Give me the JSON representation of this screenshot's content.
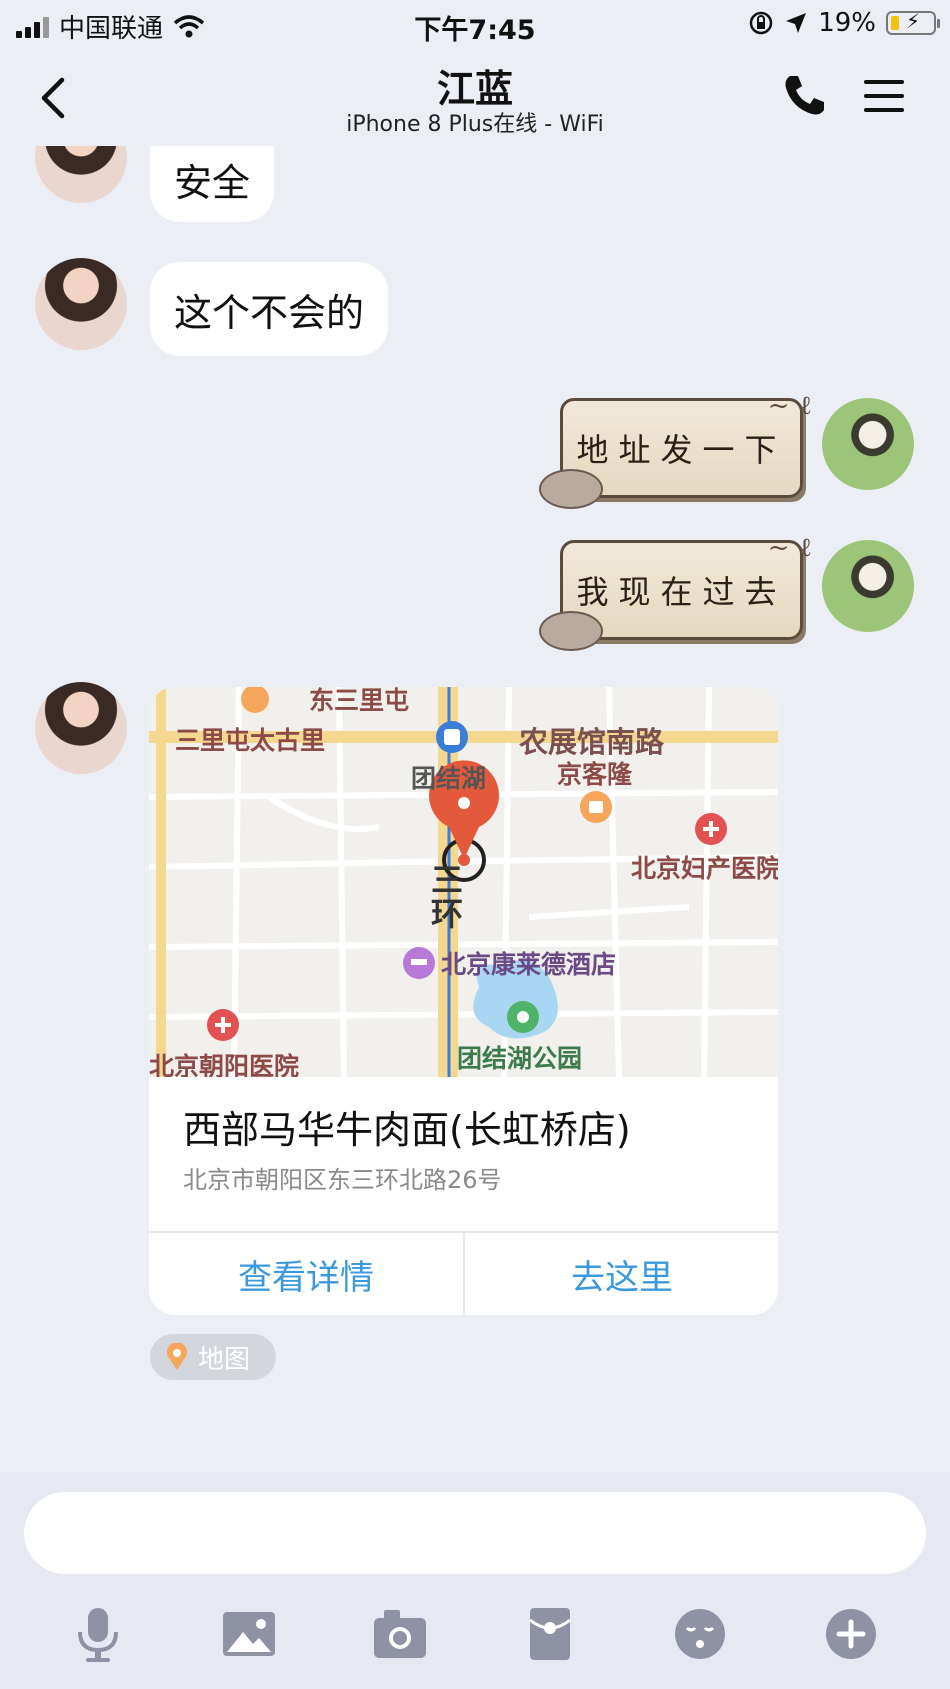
{
  "status_bar": {
    "carrier": "中国联通",
    "time": "下午7:45",
    "battery_percent": "19%",
    "battery_level": 0.19,
    "icons": [
      "signal-icon",
      "wifi-icon",
      "orientation-lock-icon",
      "location-arrow-icon",
      "battery-icon"
    ]
  },
  "nav": {
    "title": "江蓝",
    "subtitle": "iPhone 8 Plus在线 - WiFi",
    "icons": [
      "back-chevron-icon",
      "phone-icon",
      "menu-icon"
    ]
  },
  "messages": [
    {
      "side": "left",
      "text": "安全"
    },
    {
      "side": "left",
      "text": "这个不会的"
    },
    {
      "side": "right",
      "text": "地址发一下"
    },
    {
      "side": "right",
      "text": "我现在过去"
    }
  ],
  "map_card": {
    "place_name": "西部马华牛肉面(长虹桥店)",
    "address": "北京市朝阳区东三环北路26号",
    "detail_button": "查看详情",
    "go_button": "去这里",
    "tag_label": "地图",
    "map_labels": {
      "l1": "东三里屯",
      "l2": "三里屯太古里",
      "l3": "农展馆南路",
      "l4": "团结湖",
      "l5": "京客隆",
      "l6": "北京妇产医院",
      "l7": "三",
      "l8": "环",
      "l9": "北京康莱德酒店",
      "l10": "北京朝阳医院",
      "l11": "团结湖公园"
    },
    "colors": {
      "accent": "#3a98dc",
      "pin": "#e4593b",
      "road": "#f5d88f"
    }
  },
  "input": {
    "tools": [
      "microphone-icon",
      "image-icon",
      "camera-icon",
      "red-packet-icon",
      "emoji-icon",
      "plus-icon"
    ]
  }
}
